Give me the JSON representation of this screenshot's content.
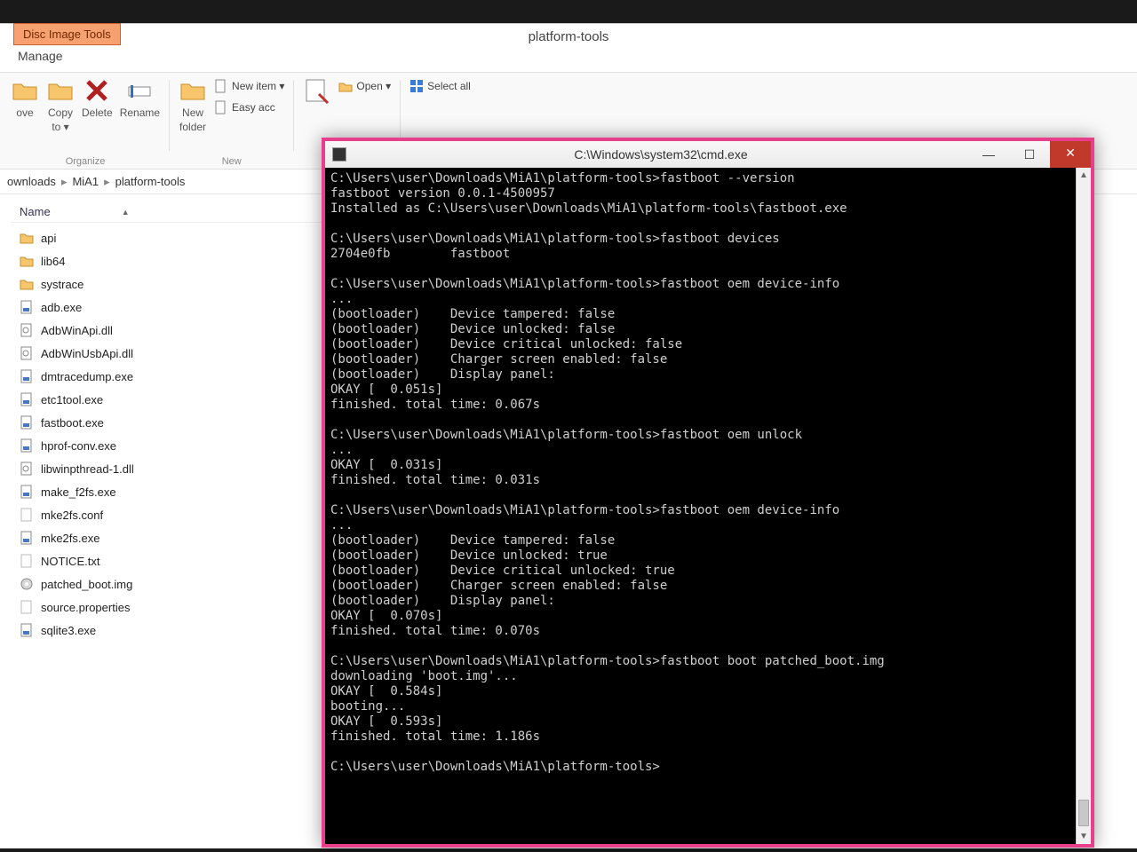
{
  "explorer": {
    "disc_tab": "Disc Image Tools",
    "manage_tab": "Manage",
    "window_title": "platform-tools",
    "ribbon": {
      "move": "ove",
      "copy": "Copy",
      "copy_sub": "to ▾",
      "delete": "Delete",
      "rename": "Rename",
      "new_folder": "New",
      "new_folder2": "folder",
      "new_item": "New item ▾",
      "easy": "Easy acc",
      "open": "Open ▾",
      "select_all": "Select all",
      "organize": "Organize",
      "new": "New"
    },
    "breadcrumbs": [
      "ownloads",
      "MiA1",
      "platform-tools"
    ],
    "name_header": "Name",
    "files": [
      {
        "name": "api",
        "type": "folder"
      },
      {
        "name": "lib64",
        "type": "folder"
      },
      {
        "name": "systrace",
        "type": "folder"
      },
      {
        "name": "adb.exe",
        "type": "exe"
      },
      {
        "name": "AdbWinApi.dll",
        "type": "dll"
      },
      {
        "name": "AdbWinUsbApi.dll",
        "type": "dll"
      },
      {
        "name": "dmtracedump.exe",
        "type": "exe"
      },
      {
        "name": "etc1tool.exe",
        "type": "exe"
      },
      {
        "name": "fastboot.exe",
        "type": "exe"
      },
      {
        "name": "hprof-conv.exe",
        "type": "exe"
      },
      {
        "name": "libwinpthread-1.dll",
        "type": "dll"
      },
      {
        "name": "make_f2fs.exe",
        "type": "exe"
      },
      {
        "name": "mke2fs.conf",
        "type": "file"
      },
      {
        "name": "mke2fs.exe",
        "type": "exe"
      },
      {
        "name": "NOTICE.txt",
        "type": "file"
      },
      {
        "name": "patched_boot.img",
        "type": "img"
      },
      {
        "name": "source.properties",
        "type": "file"
      },
      {
        "name": "sqlite3.exe",
        "type": "exe"
      }
    ]
  },
  "cmd": {
    "title": "C:\\Windows\\system32\\cmd.exe",
    "lines": [
      "C:\\Users\\user\\Downloads\\MiA1\\platform-tools>fastboot --version",
      "fastboot version 0.0.1-4500957",
      "Installed as C:\\Users\\user\\Downloads\\MiA1\\platform-tools\\fastboot.exe",
      "",
      "C:\\Users\\user\\Downloads\\MiA1\\platform-tools>fastboot devices",
      "2704e0fb        fastboot",
      "",
      "C:\\Users\\user\\Downloads\\MiA1\\platform-tools>fastboot oem device-info",
      "...",
      "(bootloader)    Device tampered: false",
      "(bootloader)    Device unlocked: false",
      "(bootloader)    Device critical unlocked: false",
      "(bootloader)    Charger screen enabled: false",
      "(bootloader)    Display panel:",
      "OKAY [  0.051s]",
      "finished. total time: 0.067s",
      "",
      "C:\\Users\\user\\Downloads\\MiA1\\platform-tools>fastboot oem unlock",
      "...",
      "OKAY [  0.031s]",
      "finished. total time: 0.031s",
      "",
      "C:\\Users\\user\\Downloads\\MiA1\\platform-tools>fastboot oem device-info",
      "...",
      "(bootloader)    Device tampered: false",
      "(bootloader)    Device unlocked: true",
      "(bootloader)    Device critical unlocked: true",
      "(bootloader)    Charger screen enabled: false",
      "(bootloader)    Display panel:",
      "OKAY [  0.070s]",
      "finished. total time: 0.070s",
      "",
      "C:\\Users\\user\\Downloads\\MiA1\\platform-tools>fastboot boot patched_boot.img",
      "downloading 'boot.img'...",
      "OKAY [  0.584s]",
      "booting...",
      "OKAY [  0.593s]",
      "finished. total time: 1.186s",
      "",
      "C:\\Users\\user\\Downloads\\MiA1\\platform-tools>"
    ]
  }
}
